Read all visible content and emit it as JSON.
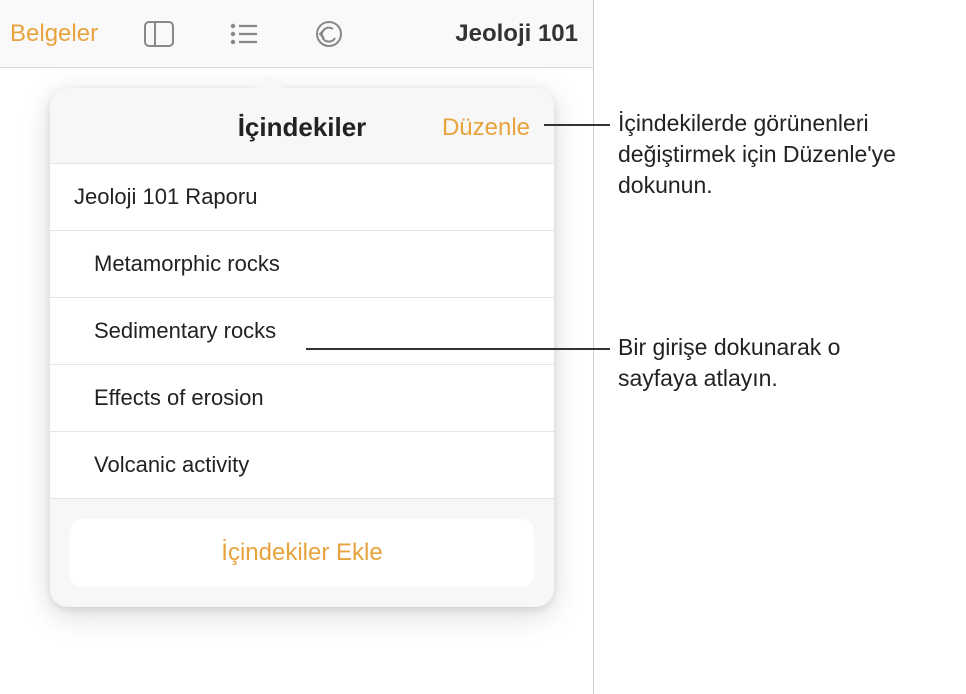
{
  "toolbar": {
    "back_label": "Belgeler",
    "doc_title": "Jeoloji 101"
  },
  "popover": {
    "title": "İçindekiler",
    "edit_label": "Düzenle",
    "items": [
      {
        "label": "Jeoloji 101 Raporu",
        "indent": false
      },
      {
        "label": "Metamorphic rocks",
        "indent": true
      },
      {
        "label": "Sedimentary rocks",
        "indent": true
      },
      {
        "label": "Effects of erosion",
        "indent": true
      },
      {
        "label": "Volcanic activity",
        "indent": true
      }
    ],
    "insert_label": "İçindekiler Ekle"
  },
  "callouts": {
    "edit": "İçindekilerde görünenleri değiştirmek için Düzenle'ye dokunun.",
    "entry": "Bir girişe dokunarak o sayfaya atlayın."
  }
}
